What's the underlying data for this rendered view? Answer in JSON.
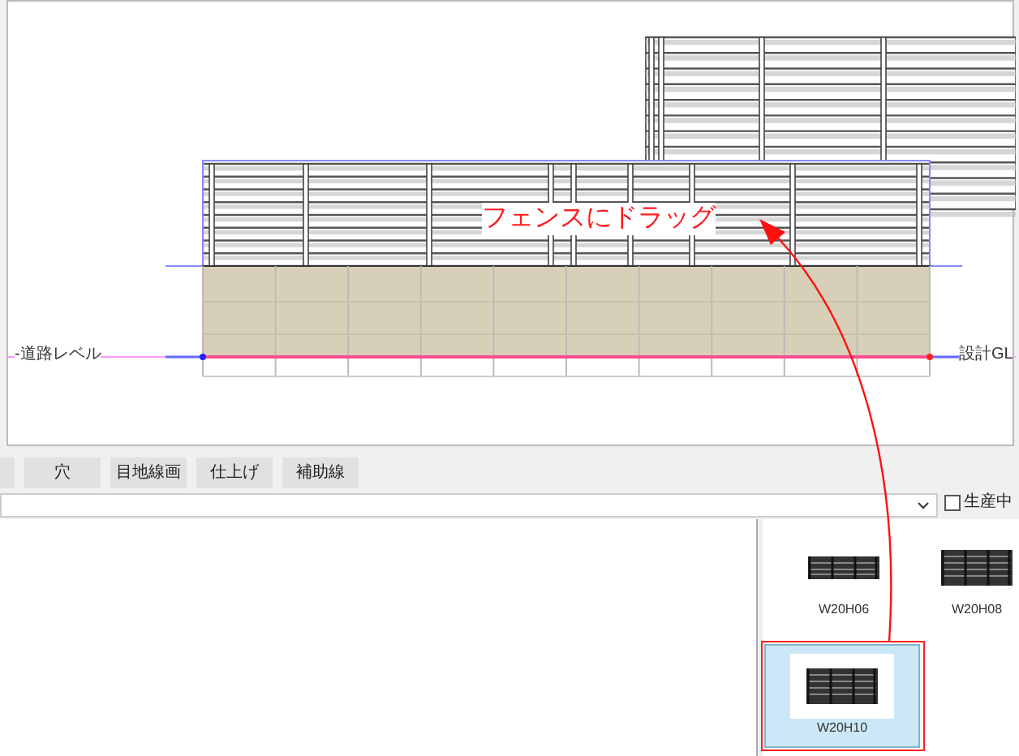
{
  "canvas": {
    "labels": [
      {
        "text": "-道路レベル"
      },
      {
        "text": "設計GL"
      }
    ],
    "callout": "フェンスにドラッグ"
  },
  "toolbar": {
    "buttons": [
      "穴",
      "目地線画",
      "仕上げ",
      "補助線"
    ]
  },
  "filter": {
    "checkbox": {
      "label": "生産中",
      "checked": false
    }
  },
  "palette": {
    "items": [
      {
        "label": "W20H06",
        "selected": false
      },
      {
        "label": "W20H08",
        "selected": false
      },
      {
        "label": "W20H10",
        "selected": true
      }
    ]
  }
}
